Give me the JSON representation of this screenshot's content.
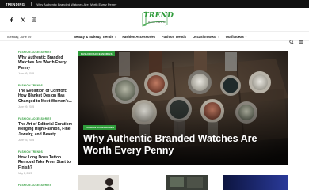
{
  "trending": {
    "label": "TRENDING",
    "headline": "Why Authentic Branded Watches Are Worth Every Penny"
  },
  "social_icons": [
    "facebook-icon",
    "twitter-icon",
    "instagram-icon"
  ],
  "logo": {
    "word": "TREND",
    "sub": "REAL NEWS"
  },
  "nav": {
    "date": "Tuesday, June 09",
    "items": [
      {
        "label": "Beauty & Makeup Trends"
      },
      {
        "label": "Fashion Accessories"
      },
      {
        "label": "Fashion Trends"
      },
      {
        "label": "Occasion Wear"
      },
      {
        "label": "Outfit Ideas"
      }
    ]
  },
  "sidebar": [
    {
      "category": "FASHION ACCESSORIES",
      "title": "Why Authentic Branded Watches Are Worth Every Penny",
      "date": "June 09, 2025"
    },
    {
      "category": "FASHION TRENDS",
      "title": "The Evolution of Comfort: How Blanket Design Has Changed to Meet Women's...",
      "date": "June 09, 2025"
    },
    {
      "category": "FASHION ACCESSORIES",
      "title": "The Art of Editorial Curation: Merging High Fashion, Fine Jewelry, and Beauty",
      "date": "June 03, 2025"
    },
    {
      "category": "FASHION TRENDS",
      "title": "How Long Does Tattoo Removal Take From Start to Finish?",
      "date": "May 1, 2025"
    },
    {
      "category": "FASHION ACCESSORIES",
      "title": "",
      "date": ""
    }
  ],
  "hero": {
    "category": "FASHION ACCESSORIES",
    "caption_category": "FASHION ACCESSORIES",
    "title": "Why Authentic Branded Watches Are Worth Every Penny"
  },
  "colors": {
    "accent": "#2e9b3a",
    "topbar": "#111111"
  }
}
